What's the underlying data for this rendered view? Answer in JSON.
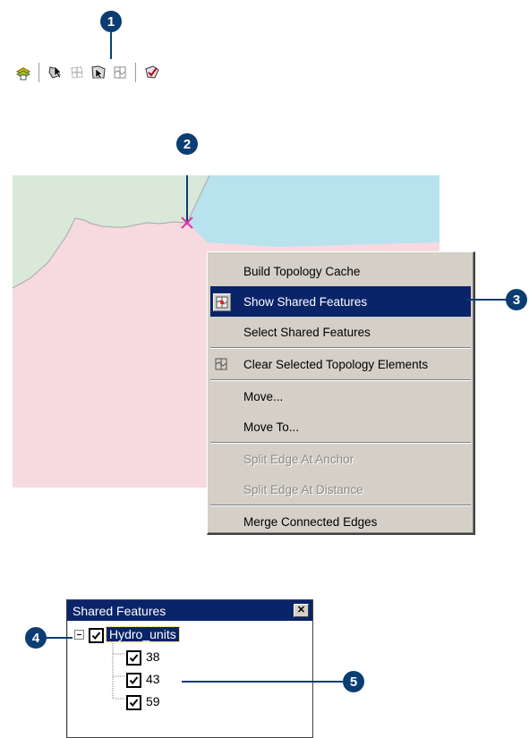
{
  "callouts": {
    "c1": "1",
    "c2": "2",
    "c3": "3",
    "c4": "4",
    "c5": "5"
  },
  "toolbar": {
    "buttons": [
      {
        "icon": "build-topology-cache-icon"
      },
      {
        "icon": "topology-edit-tool-icon"
      },
      {
        "icon": "topology-element-icon"
      },
      {
        "icon": "show-shared-features-icon"
      },
      {
        "icon": "clear-selected-elements-icon"
      },
      {
        "icon": "validate-topology-icon"
      }
    ]
  },
  "map": {
    "colors": {
      "green_region": "#d9e8d9",
      "blue_region": "#b9e2ef",
      "pink_region": "#f7d9e0",
      "anchor": "#d43aa0"
    }
  },
  "context_menu": {
    "items": [
      {
        "label": "Build Topology Cache",
        "state": "normal"
      },
      {
        "label": "Show Shared Features",
        "state": "selected",
        "icon": "show-shared-features-icon"
      },
      {
        "label": "Select Shared Features",
        "state": "normal"
      },
      {
        "label": "Clear Selected Topology Elements",
        "state": "normal",
        "icon": "clear-selected-elements-icon"
      },
      {
        "label": "Move...",
        "state": "normal"
      },
      {
        "label": "Move To...",
        "state": "normal"
      },
      {
        "label": "Split Edge At Anchor",
        "state": "disabled"
      },
      {
        "label": "Split Edge At Distance",
        "state": "disabled"
      },
      {
        "label": "Merge Connected Edges",
        "state": "normal"
      }
    ]
  },
  "shared_features": {
    "title": "Shared Features",
    "root": {
      "label": "Hydro_units",
      "checked": true,
      "expanded": true
    },
    "children": [
      {
        "label": "38",
        "checked": true
      },
      {
        "label": "43",
        "checked": true
      },
      {
        "label": "59",
        "checked": true
      }
    ]
  }
}
